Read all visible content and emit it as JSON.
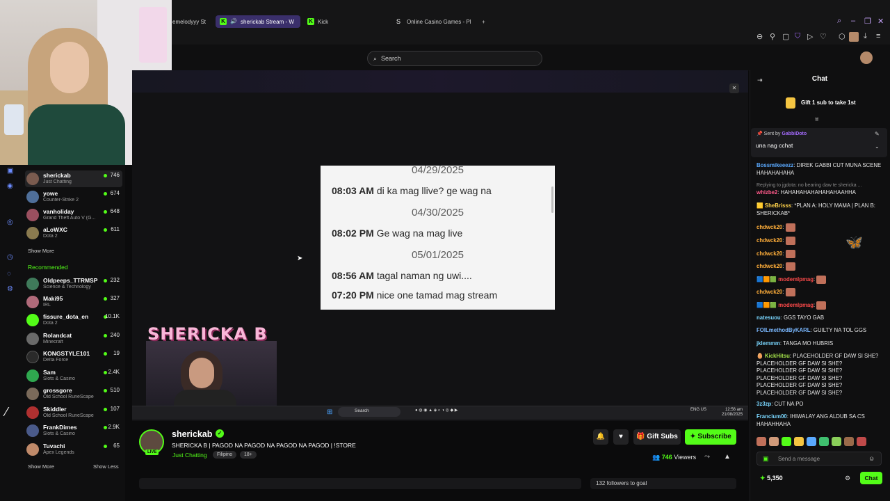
{
  "browser": {
    "tabs": [
      {
        "label": "emelodyyy St"
      },
      {
        "label": "sherickab Stream - W"
      },
      {
        "label": "Kick"
      },
      {
        "label": "Online Casino Games - Pl"
      }
    ],
    "search_placeholder": "Search"
  },
  "sidebar": {
    "channels": [
      {
        "name": "sherickab",
        "category": "Just Chatting",
        "viewers": "746",
        "color": "#7a5b4f"
      },
      {
        "name": "yowe",
        "category": "Counter-Strike 2",
        "viewers": "674",
        "color": "#4f6f9a"
      },
      {
        "name": "vanholiday",
        "category": "Grand Theft Auto V (G...",
        "viewers": "648",
        "color": "#9a4f5f"
      },
      {
        "name": "aLoWXC",
        "category": "Dota 2",
        "viewers": "611",
        "color": "#8a7a4f"
      }
    ],
    "show_more_1": "Show More",
    "recommended_label": "Recommended",
    "recommended": [
      {
        "name": "Oldpeeps_TTRMSP",
        "category": "Science & Technology",
        "viewers": "232",
        "color": "#3f7a5a"
      },
      {
        "name": "Maki95",
        "category": "IRL",
        "viewers": "327",
        "color": "#b06a7a"
      },
      {
        "name": "fissure_dota_en",
        "category": "Dota 2",
        "viewers": "10.1K",
        "color": "#53fc18"
      },
      {
        "name": "Rolandcat",
        "category": "Minecraft",
        "viewers": "240",
        "color": "#6a6a6a"
      },
      {
        "name": "KONGSTYLE101",
        "category": "Delta Force",
        "viewers": "19",
        "color": "#2a2a2a"
      },
      {
        "name": "Sam",
        "category": "Slots & Casino",
        "viewers": "2.4K",
        "color": "#2fa84f"
      },
      {
        "name": "grossgore",
        "category": "Old School RuneScape",
        "viewers": "510",
        "color": "#7a6a5a"
      },
      {
        "name": "Skiddler",
        "category": "Old School RuneScape",
        "viewers": "107",
        "color": "#b03030"
      },
      {
        "name": "FrankDimes",
        "category": "Slots & Casino",
        "viewers": "2.9K",
        "color": "#4a5a8a"
      },
      {
        "name": "Tuvachi",
        "category": "Apex Legends",
        "viewers": "65",
        "color": "#c08a6a"
      }
    ],
    "show_more_2": "Show More",
    "show_less": "Show Less"
  },
  "video": {
    "messages": [
      {
        "kind": "date",
        "text": "04/29/2025"
      },
      {
        "kind": "msg",
        "time": "08:03 AM",
        "text": "di ka mag llive? ge wag na"
      },
      {
        "kind": "date",
        "text": "04/30/2025"
      },
      {
        "kind": "msg",
        "time": "08:02 PM",
        "text": "Ge wag na mag live"
      },
      {
        "kind": "date",
        "text": "05/01/2025"
      },
      {
        "kind": "msg",
        "time": "08:56 AM",
        "text": "tagal naman ng uwi...."
      },
      {
        "kind": "msg",
        "time": "07:20 PM",
        "text": "nice one tamad mag stream"
      }
    ],
    "overlay_title": "SHERICKA B",
    "taskbar_search": "Search",
    "clock_time": "12:56 am",
    "clock_date": "21/08/2025",
    "lang": "ENG US"
  },
  "stream": {
    "live_badge": "LIVE",
    "channel_name": "sherickab",
    "title": "SHERICKA B | PAGOD NA PAGOD NA PAGOD NA PAGOD | !STORE",
    "category": "Just Chatting",
    "tags": [
      "Filipino",
      "18+"
    ],
    "gift_subs_label": "Gift Subs",
    "subscribe_label": "Subscribe",
    "viewers_count": "746",
    "viewers_label": "Viewers",
    "followers_goal": "132 followers to goal"
  },
  "chat": {
    "title": "Chat",
    "gift_banner": "Gift 1 sub to take 1st",
    "pinned_sent_by_prefix": "Sent by",
    "pinned_sent_by_user": "GabbiDoto",
    "pinned_message": "una nag cchat",
    "messages": [
      {
        "user": "Bossmikeeezz",
        "color": "#5aa9ff",
        "text": "DIREK GABBI CUT MUNA SCENE HAHAHAHAHA"
      },
      {
        "user": "whizbe2",
        "color": "#ff5a8a",
        "text": "HAHAHAHAHAHAHAHAAHHA",
        "reply": "Replying to jgdota: no bearing daw te shericka ..."
      },
      {
        "user": "SheBrisss",
        "color": "#ffd24a",
        "text": "*PLAN A: HOLY MAMA | PLAN B: SHERICKAB*"
      },
      {
        "user": "chdwck20",
        "color": "#ffae3a",
        "text": ""
      },
      {
        "user": "chdwck20",
        "color": "#ffae3a",
        "text": ""
      },
      {
        "user": "chdwck20",
        "color": "#ffae3a",
        "text": ""
      },
      {
        "user": "chdwck20",
        "color": "#ffae3a",
        "text": ""
      },
      {
        "user": "modemlpmag",
        "color": "#ff4a4a",
        "text": ""
      },
      {
        "user": "chdwck20",
        "color": "#ffae3a",
        "text": ""
      },
      {
        "user": "modemlpmag",
        "color": "#ff4a4a",
        "text": ""
      },
      {
        "user": "natesuou",
        "color": "#7ad7ff",
        "text": "GGS TAYO GAB"
      },
      {
        "user": "FOILmethodByKARL",
        "color": "#7ab8ff",
        "text": "GUILTY NA TOL GGS"
      },
      {
        "user": "jklemmm",
        "color": "#7ad7ff",
        "text": "TANGA MO HUBRIS"
      },
      {
        "user": "KickHitsu",
        "color": "#a4e24a",
        "text": "PLACEHOLDER GF DAW SI SHE? PLACEHOLDER GF DAW SI SHE?PLACEHOLDER GF DAW SI SHE?PLACEHOLDER GF DAW SI SHE?PLACEHOLDER GF DAW SI SHE?PLACEHOLDER GF DAW SI SHE?"
      },
      {
        "user": "3z3zp",
        "color": "#7ad7ff",
        "text": "CUT NA PO"
      },
      {
        "user": "Francium00",
        "color": "#7ad7ff",
        "text": "IHIWALAY ANG ALDUB SA CS HAHAHHAHA"
      }
    ],
    "input_placeholder": "Send a message",
    "points": "5,350",
    "send_label": "Chat"
  }
}
